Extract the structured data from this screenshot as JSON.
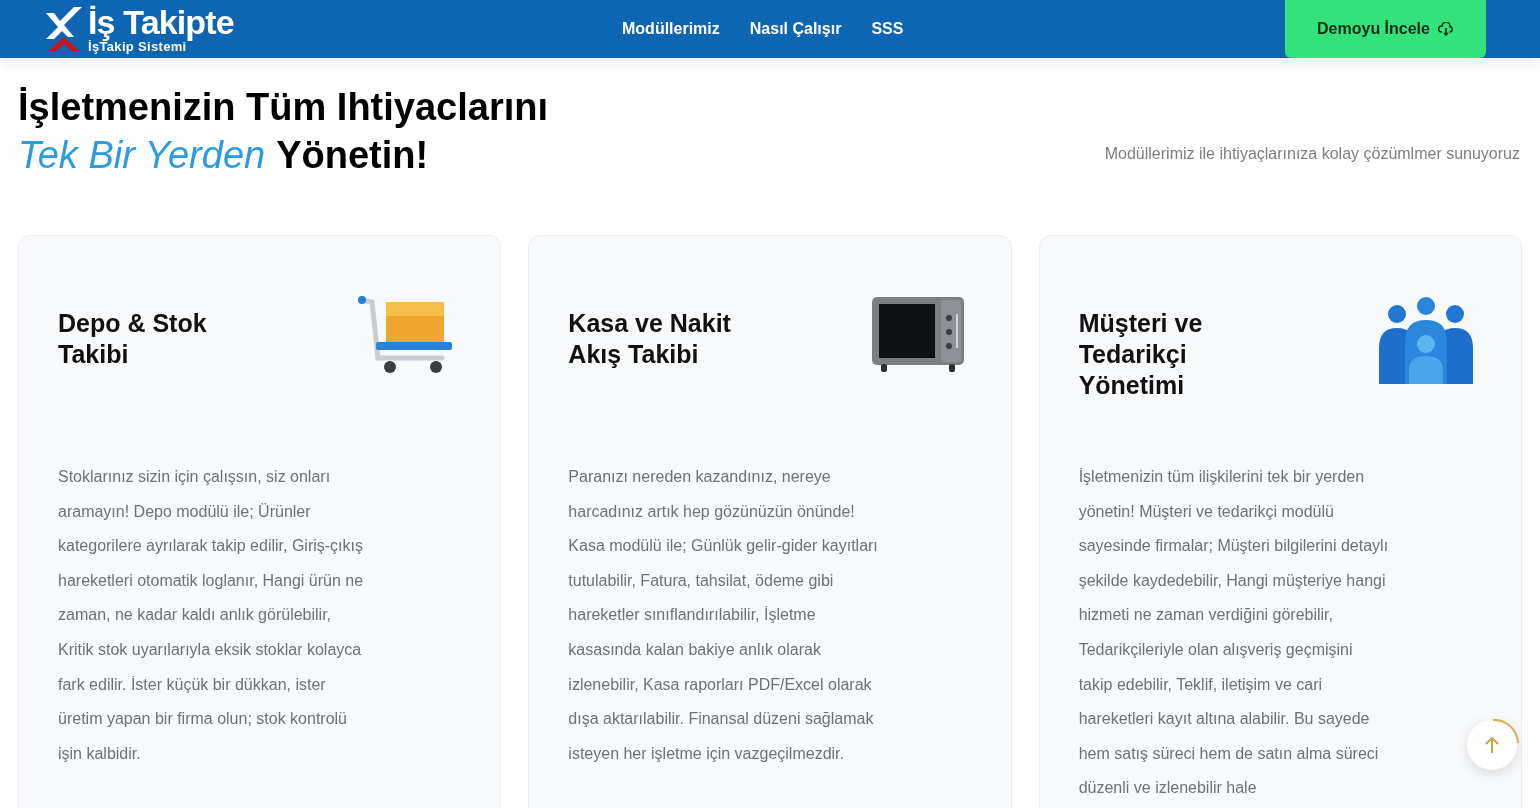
{
  "header": {
    "logo": {
      "title": "İş Takipte",
      "subtitle": "İşTakip Sistemi"
    },
    "nav": [
      {
        "label": "Modüllerimiz"
      },
      {
        "label": "Nasıl Çalışır"
      },
      {
        "label": "SSS"
      }
    ],
    "cta": {
      "label": "Demoyu İncele"
    }
  },
  "hero": {
    "title_line1": "İşletmenizin Tüm Ihtiyaclarını",
    "title_highlight": "Tek Bir Yerden",
    "title_rest": "Yönetin!",
    "subtitle": "Modüllerimiz ile ihtiyaçlarınıza kolay çözümlmer sunuyoruz"
  },
  "modules": [
    {
      "kind": "cart",
      "title": "Depo & Stok Takibi",
      "description": "Stoklarınız sizin için çalışsın, siz onları aramayın! Depo modülü ile; Ürünler kategorilere ayrılarak takip edilir, Giriş-çıkış hareketleri otomatik loglanır, Hangi ürün ne zaman, ne kadar kaldı anlık görülebilir, Kritik stok uyarılarıyla eksik stoklar kolayca fark edilir. İster küçük bir dükkan, ister üretim yapan bir firma olun; stok kontrolü işin kalbidir."
    },
    {
      "kind": "safe",
      "title": "Kasa ve Nakit Akış Takibi",
      "description": "Paranızı nereden kazandınız, nereye harcadınız artık hep gözünüzün önünde! Kasa modülü ile; Günlük gelir-gider kayıtları tutulabilir, Fatura, tahsilat, ödeme gibi hareketler sınıflandırılabilir, İşletme kasasında kalan bakiye anlık olarak izlenebilir, Kasa raporları PDF/Excel olarak dışa aktarılabilir. Finansal düzeni sağlamak isteyen her işletme için vazgeçilmezdir."
    },
    {
      "kind": "people",
      "title": "Müşteri ve Tedarikçi Yönetimi",
      "description": "İşletmenizin tüm ilişkilerini tek bir yerden yönetin! Müşteri ve tedarikçi modülü sayesinde firmalar; Müşteri bilgilerini detaylı şekilde kaydedebilir, Hangi müşteriye hangi hizmeti ne zaman verdiğini görebilir, Tedarikçileriyle olan alışveriş geçmişini takip edebilir, Teklif, iletişim ve cari hareketleri kayıt altına alabilir. Bu sayede hem satış süreci hem de satın alma süreci düzenli ve izlenebilir hale"
    }
  ]
}
